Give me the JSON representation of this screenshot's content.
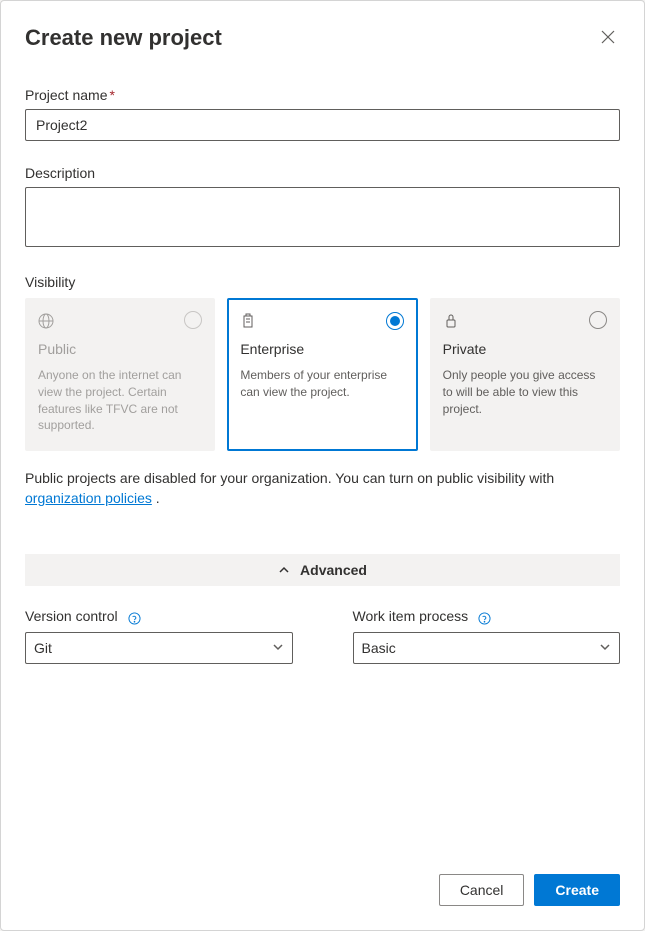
{
  "dialog": {
    "title": "Create new project"
  },
  "fields": {
    "project_name": {
      "label": "Project name",
      "value": "Project2"
    },
    "description": {
      "label": "Description",
      "value": ""
    },
    "visibility": {
      "label": "Visibility",
      "options": [
        {
          "title": "Public",
          "desc": "Anyone on the internet can view the project. Certain features like TFVC are not supported.",
          "disabled": true
        },
        {
          "title": "Enterprise",
          "desc": "Members of your enterprise can view the project.",
          "selected": true
        },
        {
          "title": "Private",
          "desc": "Only people you give access to will be able to view this project."
        }
      ]
    }
  },
  "notice": {
    "text_before": "Public projects are disabled for your organization. You can turn on public visibility with ",
    "link": "organization policies",
    "text_after": " ."
  },
  "advanced": {
    "label": "Advanced",
    "version_control": {
      "label": "Version control",
      "value": "Git"
    },
    "work_item_process": {
      "label": "Work item process",
      "value": "Basic"
    }
  },
  "footer": {
    "cancel": "Cancel",
    "create": "Create"
  }
}
